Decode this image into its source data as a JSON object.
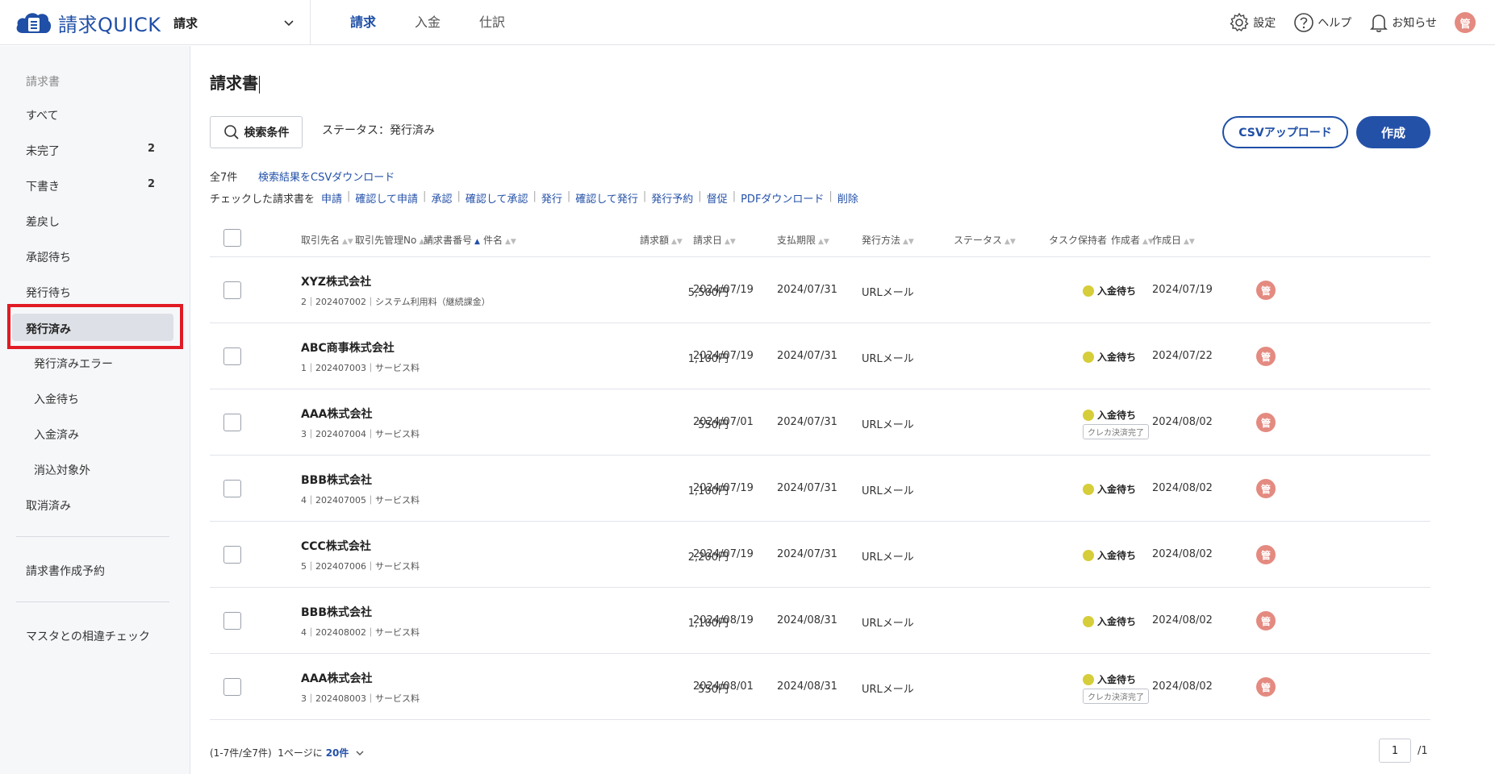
{
  "app": {
    "logo_text": "請求QUICK",
    "service": "請求"
  },
  "top_nav": [
    "請求",
    "入金",
    "仕訳"
  ],
  "header_right": {
    "settings": "設定",
    "help": "ヘルプ",
    "notice": "お知らせ",
    "avatar": "管"
  },
  "sidebar": {
    "heading": "請求書",
    "items": [
      {
        "label": "すべて",
        "count": ""
      },
      {
        "label": "未完了",
        "count": "2"
      },
      {
        "label": "下書き",
        "count": "2"
      },
      {
        "label": "差戻し",
        "count": ""
      },
      {
        "label": "承認待ち",
        "count": ""
      },
      {
        "label": "発行待ち",
        "count": ""
      },
      {
        "label": "発行済み",
        "count": ""
      },
      {
        "label": "発行済みエラー",
        "count": ""
      },
      {
        "label": "入金待ち",
        "count": ""
      },
      {
        "label": "入金済み",
        "count": ""
      },
      {
        "label": "消込対象外",
        "count": ""
      },
      {
        "label": "取消済み",
        "count": ""
      },
      {
        "label": "請求書作成予約",
        "count": ""
      },
      {
        "label": "マスタとの相違チェック",
        "count": ""
      }
    ]
  },
  "main": {
    "title": "請求書",
    "search_label": "検索条件",
    "status_filter": "ステータス：発行済み",
    "csv_upload": "CSVアップロード",
    "create": "作成",
    "total": "全7件",
    "csv_download": "検索結果をCSVダウンロード",
    "actions_lead": "チェックした請求書を",
    "actions": [
      "申請",
      "確認して申請",
      "承認",
      "確認して承認",
      "発行",
      "確認して発行",
      "発行予約",
      "督促",
      "PDFダウンロード",
      "削除"
    ]
  },
  "table": {
    "headers": {
      "client": "取引先名",
      "client_no": "取引先管理No",
      "invoice_no": "請求書番号",
      "subject": "件名",
      "amount": "請求額",
      "date": "請求日",
      "due": "支払期限",
      "method": "発行方法",
      "status": "ステータス",
      "task": "タスク保持者",
      "creator": "作成者",
      "created": "作成日"
    },
    "rows": [
      {
        "client": "XYZ株式会社",
        "sub": "2｜202407002｜システム利用料（継続課金）",
        "amount": "5,500円",
        "date": "2024/07/19",
        "due": "2024/07/31",
        "method": "URLメール",
        "status": "入金待ち",
        "tag": "",
        "creator": "管",
        "created": "2024/07/19"
      },
      {
        "client": "ABC商事株式会社",
        "sub": "1｜202407003｜サービス料",
        "amount": "1,100円",
        "date": "2024/07/19",
        "due": "2024/07/31",
        "method": "URLメール",
        "status": "入金待ち",
        "tag": "",
        "creator": "管",
        "created": "2024/07/22"
      },
      {
        "client": "AAA株式会社",
        "sub": "3｜202407004｜サービス料",
        "amount": "550円",
        "date": "2024/07/01",
        "due": "2024/07/31",
        "method": "URLメール",
        "status": "入金待ち",
        "tag": "クレカ決済完了",
        "creator": "管",
        "created": "2024/08/02"
      },
      {
        "client": "BBB株式会社",
        "sub": "4｜202407005｜サービス料",
        "amount": "1,100円",
        "date": "2024/07/19",
        "due": "2024/07/31",
        "method": "URLメール",
        "status": "入金待ち",
        "tag": "",
        "creator": "管",
        "created": "2024/08/02"
      },
      {
        "client": "CCC株式会社",
        "sub": "5｜202407006｜サービス料",
        "amount": "2,200円",
        "date": "2024/07/19",
        "due": "2024/07/31",
        "method": "URLメール",
        "status": "入金待ち",
        "tag": "",
        "creator": "管",
        "created": "2024/08/02"
      },
      {
        "client": "BBB株式会社",
        "sub": "4｜202408002｜サービス料",
        "amount": "1,100円",
        "date": "2024/08/19",
        "due": "2024/08/31",
        "method": "URLメール",
        "status": "入金待ち",
        "tag": "",
        "creator": "管",
        "created": "2024/08/02"
      },
      {
        "client": "AAA株式会社",
        "sub": "3｜202408003｜サービス料",
        "amount": "550円",
        "date": "2024/08/01",
        "due": "2024/08/31",
        "method": "URLメール",
        "status": "入金待ち",
        "tag": "クレカ決済完了",
        "creator": "管",
        "created": "2024/08/02"
      }
    ]
  },
  "footer": {
    "range": "(1-7件/全7件)",
    "per_page_label": "1ページに",
    "per_page": "20件",
    "page": "1",
    "page_total": "/1"
  },
  "colors": {
    "brand": "#1f4fa6",
    "highlight_box": "#e01b24",
    "status_dot": "#d6cd3a",
    "avatar": "#e48a80"
  }
}
